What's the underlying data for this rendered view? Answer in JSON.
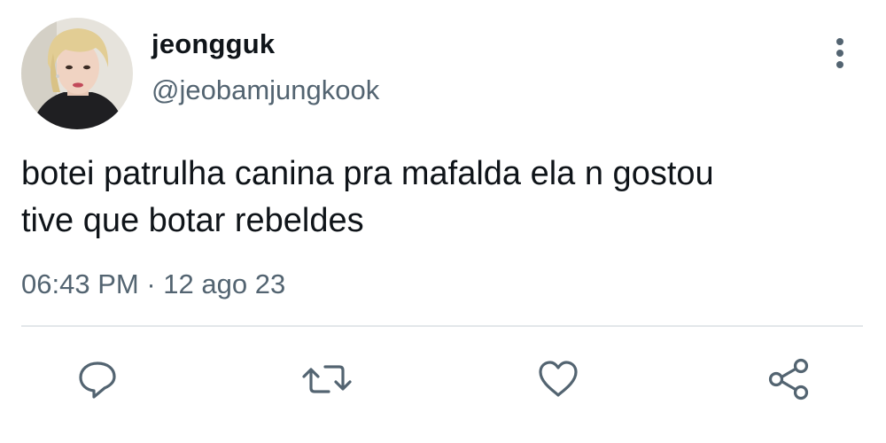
{
  "author": {
    "display_name": "jeongguk",
    "handle": "@jeobamjungkook"
  },
  "tweet": {
    "text_lines": [
      "botei patrulha canina pra mafalda ela n gostou",
      "tive que botar rebeldes"
    ],
    "time": "06:43 PM",
    "separator": "·",
    "date": "12 ago 23"
  },
  "icons": {
    "more": "more-vertical-icon",
    "reply": "reply-icon",
    "retweet": "retweet-icon",
    "like": "heart-icon",
    "share": "share-icon"
  },
  "colors": {
    "text": "#0f1419",
    "secondary": "#536471",
    "divider": "#e3e7ea"
  }
}
